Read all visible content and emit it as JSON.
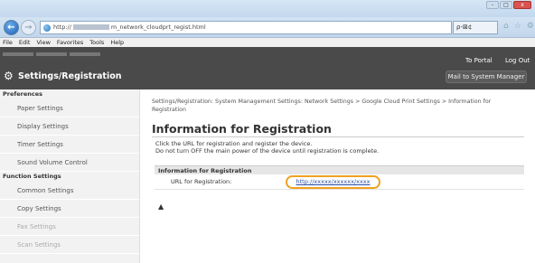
{
  "browser": {
    "url_prefix": "http://",
    "url_middle": "m_",
    "url_suffix": "network_cloudprt_regist.html",
    "search": "ρ-⊠¢",
    "menu": [
      "File",
      "Edit",
      "View",
      "Favorites",
      "Tools",
      "Help"
    ],
    "window_buttons": [
      "-",
      "□",
      "x"
    ],
    "toolbar_icons": [
      "home-icon",
      "star-icon",
      "gear-icon"
    ]
  },
  "app": {
    "title": "Settings/Registration",
    "to_portal": "To Portal",
    "logout": "Log Out",
    "mail_admin": "Mail to System Manager"
  },
  "sidebar": {
    "preferences_header": "Preferences",
    "preferences": [
      "Paper Settings",
      "Display Settings",
      "Timer Settings",
      "Sound Volume Control"
    ],
    "function_header": "Function Settings",
    "functions": [
      "Common Settings",
      "Copy Settings",
      "Fax Settings",
      "Scan Settings"
    ]
  },
  "main": {
    "breadcrumb": "Settings/Registration: System Management Settings: Network Settings > Google Cloud Print Settings > Information for Registration",
    "heading": "Information for Registration",
    "desc1": "Click the URL for registration and register the device.",
    "desc2": "Do not turn OFF the main power of the device until registration is complete.",
    "table_header": "Information for Registration",
    "row_label": "URL for Registration:",
    "row_value": "http://xxxxx/xxxxxx/xxxx",
    "top_arrow": "▲"
  }
}
